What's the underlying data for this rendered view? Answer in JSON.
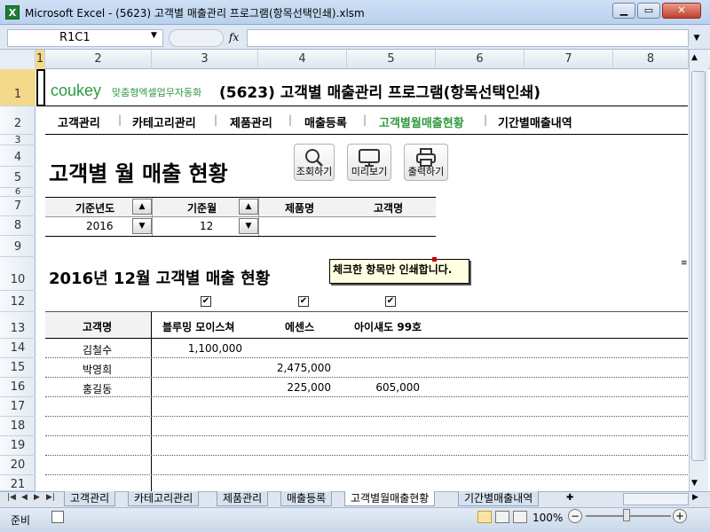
{
  "window": {
    "title": "Microsoft Excel - (5623) 고객별 매출관리 프로그램(항목선택인쇄).xlsm",
    "app_icon": "excel-icon",
    "min": "▁",
    "max": "▭",
    "close": "✕"
  },
  "formula_bar": {
    "name_box": "R1C1",
    "fx": "fx",
    "formula": ""
  },
  "columns": [
    "1",
    "2",
    "3",
    "4",
    "5",
    "6",
    "7",
    "8"
  ],
  "rows": [
    "1",
    "2",
    "3",
    "4",
    "5",
    "6",
    "7",
    "8",
    "9",
    "10",
    "11",
    "12",
    "13",
    "14",
    "15",
    "16",
    "17",
    "18",
    "19",
    "20",
    "21"
  ],
  "brand": {
    "logo": "coukey",
    "tagline": "맞춤형엑셀업무자동화",
    "title": "(5623) 고객별 매출관리 프로그램(항목선택인쇄)"
  },
  "menu": [
    {
      "label": "고객관리",
      "active": false
    },
    {
      "label": "카테고리관리",
      "active": false
    },
    {
      "label": "제품관리",
      "active": false
    },
    {
      "label": "매출등록",
      "active": false
    },
    {
      "label": "고객별월매출현황",
      "active": true
    },
    {
      "label": "기간별매출내역",
      "active": false
    }
  ],
  "page_title": "고객별 월 매출 현황",
  "toolbar": {
    "search": "조회하기",
    "preview": "미리보기",
    "print": "출력하기"
  },
  "filter": {
    "headers": [
      "기준년도",
      "기준월",
      "제품명",
      "고객명"
    ],
    "year": "2016",
    "month": "12",
    "product": "",
    "customer": ""
  },
  "report_title": "2016년 12월 고객별 매출 현황",
  "tooltip": "체크한 항목만 인쇄합니다.",
  "table": {
    "checks": [
      "✔",
      "✔",
      "✔"
    ],
    "headers": [
      "고객명",
      "블루밍 모이스쳐",
      "에센스",
      "아이섀도 99호"
    ],
    "rows": [
      [
        "김철수",
        "1,100,000",
        "",
        ""
      ],
      [
        "박영희",
        "",
        "2,475,000",
        ""
      ],
      [
        "홍길동",
        "",
        "225,000",
        "605,000"
      ]
    ]
  },
  "sheet_tabs": [
    "고객관리",
    "카테고리관리",
    "제품관리",
    "매출등록",
    "고객별월매출현황",
    "기간별매출내역"
  ],
  "status": {
    "ready": "준비",
    "zoom": "100%"
  },
  "colors": {
    "accent_green": "#2e9a3e",
    "window_blue": "#b9d1ee"
  }
}
